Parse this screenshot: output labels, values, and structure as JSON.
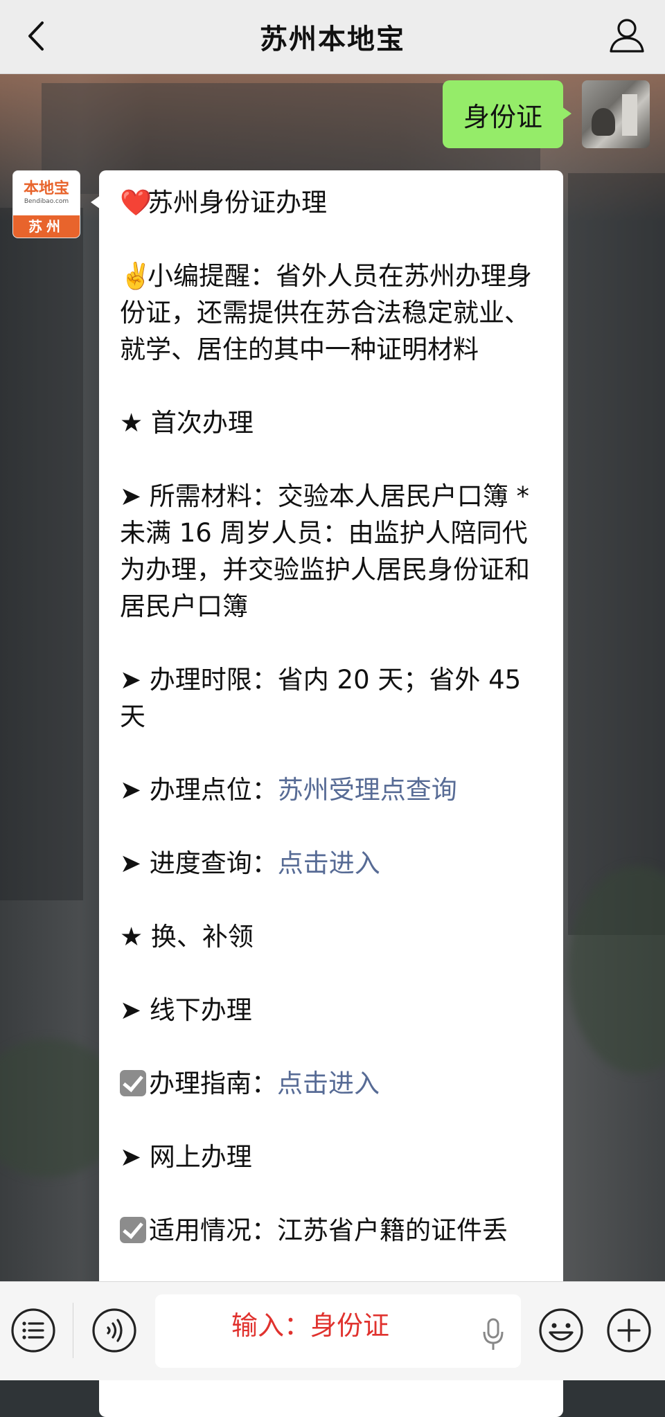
{
  "header": {
    "title": "苏州本地宝"
  },
  "outgoing": {
    "text": "身份证"
  },
  "bot": {
    "logo_main": "本地宝",
    "logo_sub": "Bendibao.com",
    "logo_city": "苏州"
  },
  "message": {
    "heading_emoji": "❤️",
    "heading": "苏州身份证办理",
    "tip_emoji": "✌️",
    "tip": "小编提醒：省外人员在苏州办理身份证，还需提供在苏合法稳定就业、就学、居住的其中一种证明材料",
    "section1": "★ 首次办理",
    "materials": "➤ 所需材料：交验本人居民户口簿 *未满 16 周岁人员：由监护人陪同代为办理，并交验监护人居民身份证和居民户口簿",
    "time_limit": "➤ 办理时限：省内 20 天；省外 45 天",
    "location_label": "➤ 办理点位：",
    "location_link": "苏州受理点查询",
    "progress_label": "➤ 进度查询：",
    "progress_link": "点击进入",
    "section2": "★ 换、补领",
    "offline": "➤ 线下办理",
    "guide_label": "办理指南：",
    "guide_link": "点击进入",
    "online": "➤ 网上办理",
    "applicable": "适用情况：江苏省户籍的证件丢"
  },
  "input": {
    "text": "输入：身份证"
  },
  "icons": {
    "back": "back-arrow-icon",
    "user": "user-icon",
    "menu": "menu-list-icon",
    "voice": "voice-icon",
    "mic": "mic-icon",
    "emoji": "emoji-icon",
    "add": "add-icon"
  }
}
